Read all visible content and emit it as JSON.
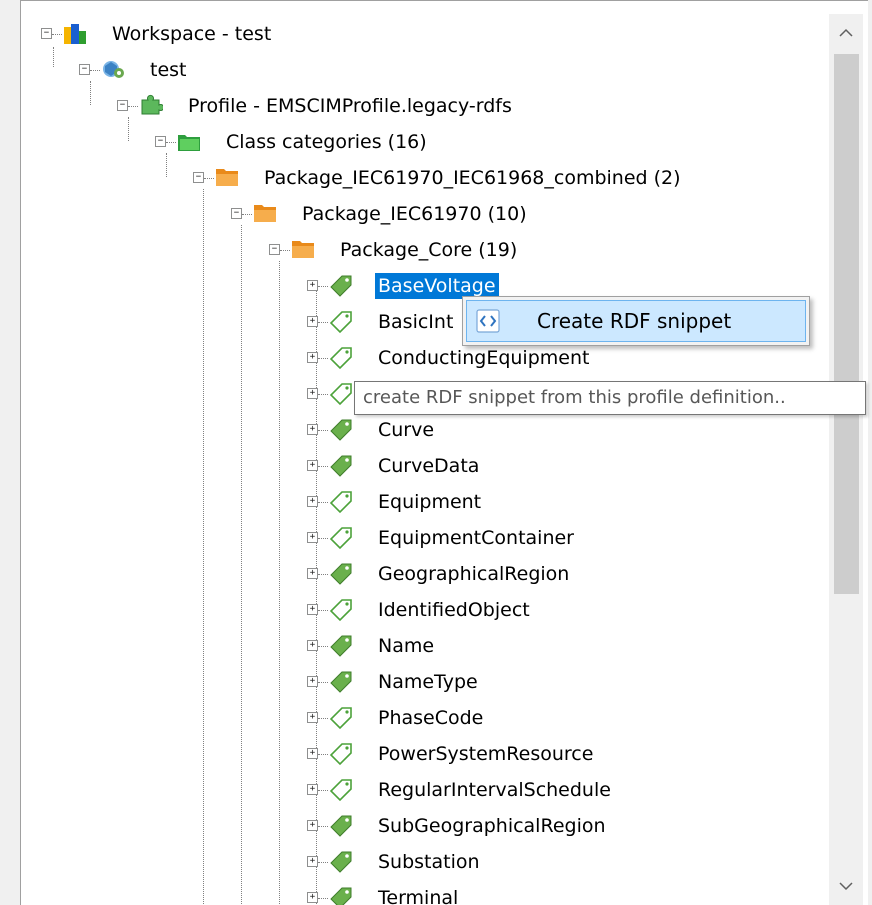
{
  "tree": {
    "root": {
      "label": "Workspace - test",
      "icon": "workspace-icon",
      "expanded": true
    },
    "project": {
      "label": "test",
      "icon": "project-icon",
      "expanded": true
    },
    "profile": {
      "label": "Profile - EMSCIMProfile.legacy-rdfs",
      "icon": "puzzle-icon",
      "expanded": true
    },
    "categories": {
      "label": "Class categories (16)",
      "icon": "green-folder-icon",
      "expanded": true
    },
    "package1": {
      "label": "Package_IEC61970_IEC61968_combined (2)",
      "icon": "folder-icon",
      "expanded": true
    },
    "package2": {
      "label": "Package_IEC61970 (10)",
      "icon": "folder-icon",
      "expanded": true
    },
    "package3": {
      "label": "Package_Core (19)",
      "icon": "folder-icon",
      "expanded": true
    },
    "classes": [
      {
        "label": "BaseVoltage",
        "icon": "class-tag-filled-icon",
        "selected": true
      },
      {
        "label": "BasicInt",
        "icon": "class-tag-outline-icon"
      },
      {
        "label": "ConductingEquipment",
        "icon": "class-tag-outline-icon"
      },
      {
        "label": "",
        "icon": "class-tag-outline-icon"
      },
      {
        "label": "Curve",
        "icon": "class-tag-filled-icon"
      },
      {
        "label": "CurveData",
        "icon": "class-tag-filled-icon"
      },
      {
        "label": "Equipment",
        "icon": "class-tag-outline-icon"
      },
      {
        "label": "EquipmentContainer",
        "icon": "class-tag-outline-icon"
      },
      {
        "label": "GeographicalRegion",
        "icon": "class-tag-filled-icon"
      },
      {
        "label": "IdentifiedObject",
        "icon": "class-tag-outline-icon"
      },
      {
        "label": "Name",
        "icon": "class-tag-filled-icon"
      },
      {
        "label": "NameType",
        "icon": "class-tag-filled-icon"
      },
      {
        "label": "PhaseCode",
        "icon": "class-tag-outline-icon"
      },
      {
        "label": "PowerSystemResource",
        "icon": "class-tag-outline-icon"
      },
      {
        "label": "RegularIntervalSchedule",
        "icon": "class-tag-outline-icon"
      },
      {
        "label": "SubGeographicalRegion",
        "icon": "class-tag-filled-icon"
      },
      {
        "label": "Substation",
        "icon": "class-tag-filled-icon"
      },
      {
        "label": "Terminal",
        "icon": "class-tag-filled-icon"
      }
    ]
  },
  "context_menu": {
    "items": [
      {
        "label": "Create RDF snippet",
        "icon": "rdf-snippet-icon"
      }
    ]
  },
  "tooltip": {
    "text": "create RDF snippet from this profile definition.."
  },
  "scrollbar": {
    "up_icon": "chevron-up-icon",
    "down_icon": "chevron-down-icon"
  },
  "colors": {
    "selection": "#0078d7",
    "menu_highlight": "#cce8ff",
    "class_green": "#6ab04c",
    "folder_orange": "#f5a623"
  }
}
